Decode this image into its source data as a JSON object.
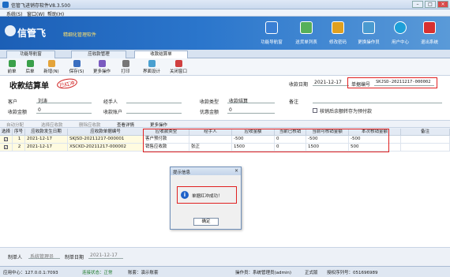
{
  "window": {
    "title": "信管飞进销存软件V8.3.500"
  },
  "menu": [
    "系统(S)",
    "窗口(W)",
    "帮助(H)"
  ],
  "banner": {
    "brand": "信管飞",
    "slogan": "精细化管理软件",
    "buttons": [
      {
        "label": "功能导航窗",
        "color": "#3a7fd4"
      },
      {
        "label": "送货单列表",
        "color": "#56b05a"
      },
      {
        "label": "修改密码",
        "color": "#e0a020"
      },
      {
        "label": "更换操作员",
        "color": "#4a9ad0"
      },
      {
        "label": "用户中心",
        "color": "#1e9fd8"
      },
      {
        "label": "退出系统",
        "color": "#d83030"
      }
    ]
  },
  "tabs": [
    "功能导航窗",
    "应收款管理",
    "收款结算单"
  ],
  "toolbar": [
    "前单",
    "后单",
    "新增(N)",
    "保存(S)",
    "更多操作",
    "打印",
    "界面设计",
    "关闭窗口"
  ],
  "form": {
    "title": "收款结算单",
    "stamp": "已红冲",
    "date_label": "收款日期",
    "date_value": "2021-12-17",
    "number_label": "单据编号",
    "number_value": "SKJSD-20211217-000002",
    "customer_label": "客户",
    "customer_value": "刘涛",
    "handler_label": "经手人",
    "handler_value": "",
    "type_label": "收款类型",
    "type_value": "收款结算",
    "remark_label": "备注",
    "amount_label": "收款金额",
    "amount_value": "0",
    "account_label": "收款账户",
    "account_value": "",
    "discount_label": "优惠金额",
    "discount_value": "0",
    "checkbox_label": "核销后余额转存为预付款"
  },
  "gridbar": [
    "自动分配",
    "选择应收款",
    "删除应收款",
    "查看详情",
    "更多操作"
  ],
  "grid": {
    "headers": [
      "选择",
      "序号",
      "应收款发生日期",
      "应收款单据编号",
      "应收款类型",
      "经手人",
      "应收金额",
      "当前已核销",
      "当前可核销金额",
      "本次核销金额",
      "备注"
    ],
    "rows": [
      [
        "1",
        "2021-12-17",
        "SKJSD-20211217-000001",
        "客户预付款",
        "",
        "-500",
        "0",
        "-500",
        "-500",
        ""
      ],
      [
        "2",
        "2021-12-17",
        "XSCKD-20211217-000002",
        "销售应收款",
        "张正",
        "1500",
        "0",
        "1500",
        "500",
        ""
      ]
    ]
  },
  "dialog": {
    "title": "提示信息",
    "message": "单据红冲成功！",
    "ok": "确定"
  },
  "bottom": {
    "maker_label": "制单人",
    "maker_value": "系统管理员",
    "make_date_label": "制单日期",
    "make_date_value": "2021-12-17"
  },
  "status": {
    "server": "应用中心：127.0.0.1:7093",
    "conn": "连接状态：正常",
    "db": "账套：演示账套",
    "op": "操作员：系统管理员(admin)",
    "edition": "正式版",
    "auth": "授权序列号：051696989"
  }
}
